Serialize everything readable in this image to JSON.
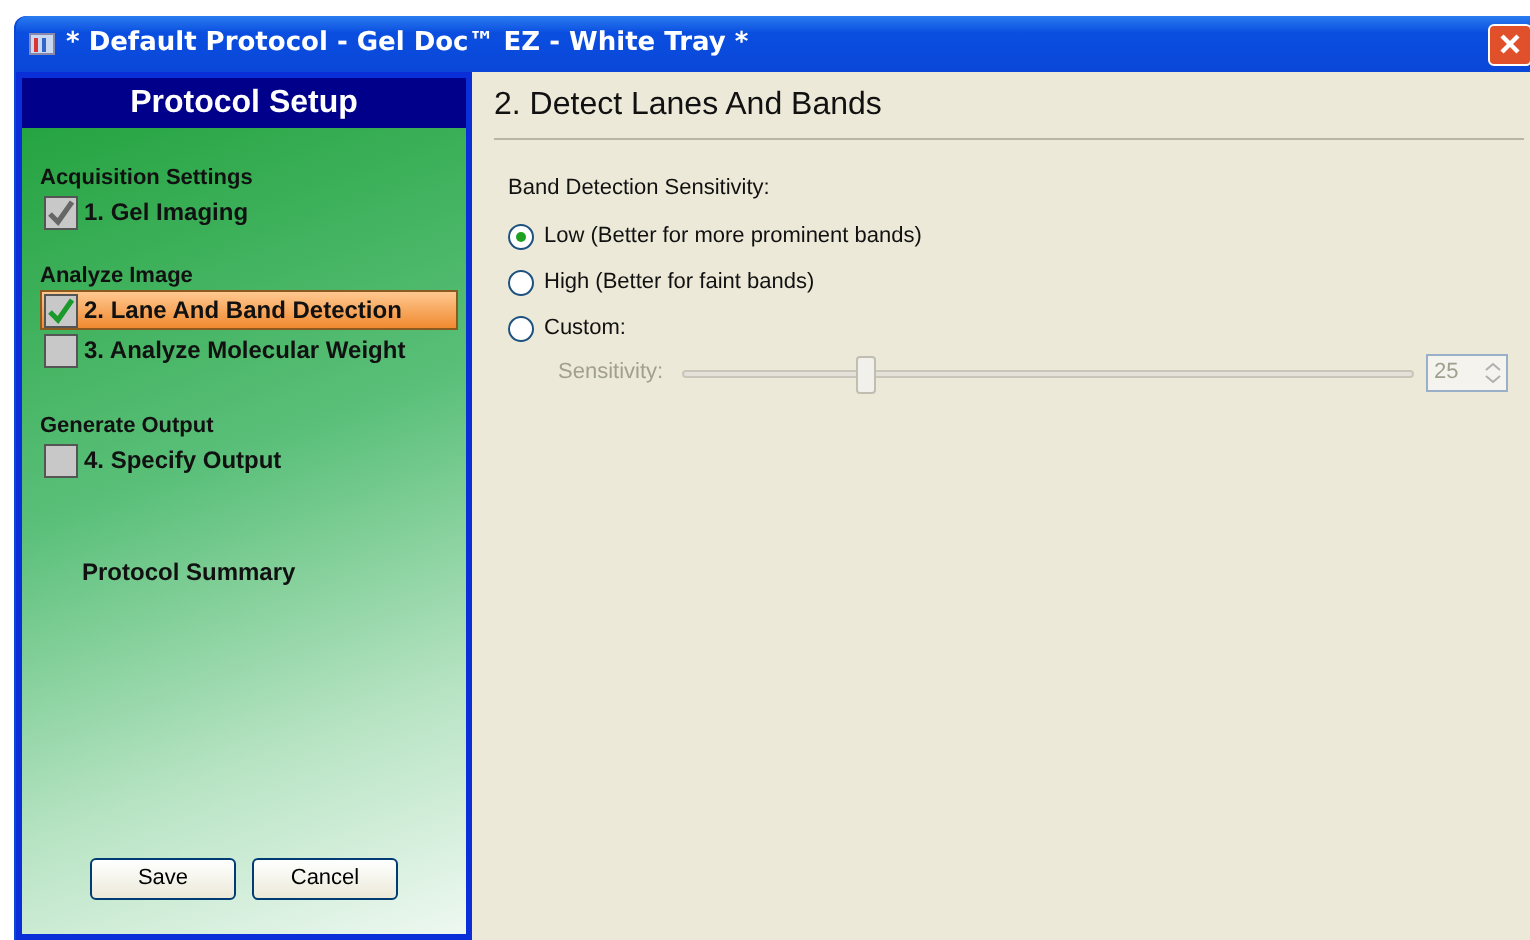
{
  "window": {
    "title": "* Default Protocol - Gel Doc™ EZ - White Tray *"
  },
  "sidebar": {
    "title": "Protocol Setup",
    "sections": [
      {
        "heading": "Acquisition Settings",
        "items": [
          {
            "label": "1. Gel Imaging",
            "checked": true,
            "selected": false
          }
        ]
      },
      {
        "heading": "Analyze Image",
        "items": [
          {
            "label": "2. Lane And Band Detection",
            "checked": true,
            "selected": true
          },
          {
            "label": "3. Analyze Molecular Weight",
            "checked": false,
            "selected": false
          }
        ]
      },
      {
        "heading": "Generate Output",
        "items": [
          {
            "label": "4. Specify Output",
            "checked": false,
            "selected": false
          }
        ]
      }
    ],
    "summary": "Protocol Summary",
    "buttons": [
      "Save",
      "Cancel"
    ]
  },
  "main": {
    "title": "2. Detect Lanes And Bands",
    "group_label": "Band Detection Sensitivity:",
    "options": [
      {
        "label": "Low (Better for more prominent bands)",
        "selected": true
      },
      {
        "label": "High (Better for faint bands)",
        "selected": false
      },
      {
        "label": "Custom:",
        "selected": false
      }
    ],
    "slider": {
      "label": "Sensitivity:",
      "level": 0.25,
      "value": "25",
      "disabled": true
    }
  }
}
